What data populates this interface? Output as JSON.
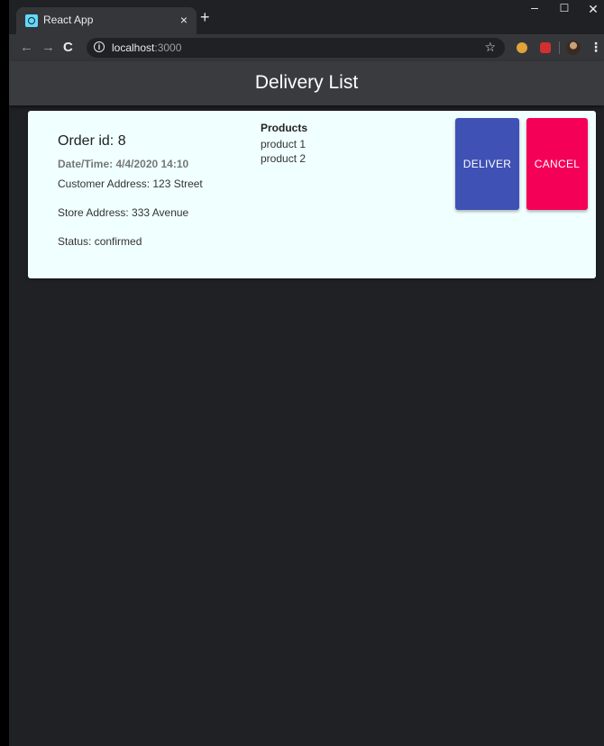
{
  "browser": {
    "tab_title": "React App",
    "tab_close": "×",
    "new_tab": "+",
    "url_host": "localhost",
    "url_port": ":3000",
    "info_glyph": "i",
    "star_glyph": "☆",
    "menu_glyph": "⋮",
    "window_controls": {
      "minimize": "–",
      "maximize": "☐",
      "close": "✕"
    },
    "nav": {
      "back": "←",
      "forward": "→",
      "reload": "C"
    }
  },
  "app": {
    "title": "Delivery List"
  },
  "order": {
    "id_text": "Order id: 8",
    "datetime_text": "Date/Time: 4/4/2020 14:10",
    "customer_address_text": "Customer Address: 123 Street",
    "store_address_text": "Store Address: 333 Avenue",
    "status_text": "Status: confirmed",
    "products_title": "Products",
    "products": [
      "product 1",
      "product 2"
    ],
    "deliver_label": "DELIVER",
    "cancel_label": "CANCEL"
  },
  "colors": {
    "deliver": "#3f51b5",
    "cancel": "#f50057",
    "card_bg": "#f0ffff",
    "page_bg": "#202124"
  },
  "icons": {
    "favicon": "react-icon",
    "info": "info-icon",
    "star": "star-icon",
    "menu": "kebab-menu-icon"
  }
}
